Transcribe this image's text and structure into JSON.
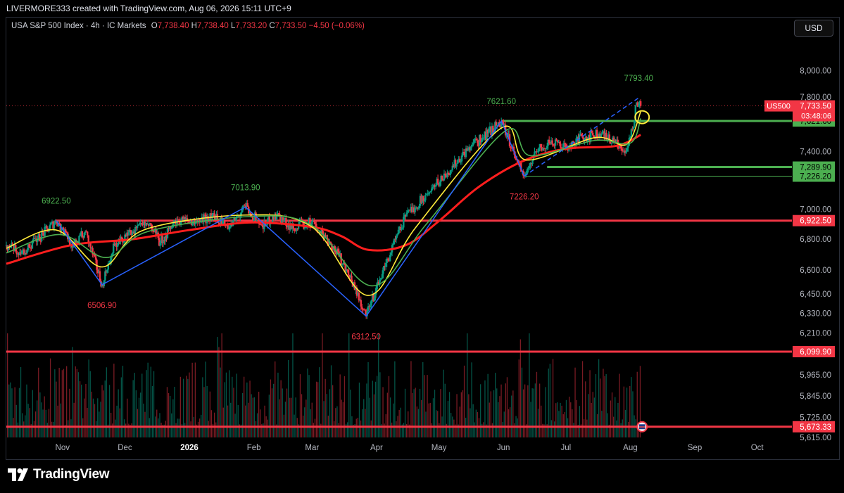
{
  "header": {
    "attribution": "LIVERMORE333 created with TradingView.com, Aug 06, 2026 15:11 UTC+9"
  },
  "legend": {
    "symbol": "USA S&P 500 Index · 4h · IC Markets",
    "o_label": "O",
    "o_value": "7,738.40",
    "h_label": "H",
    "h_value": "7,738.40",
    "l_label": "L",
    "l_value": "7,733.20",
    "c_label": "C",
    "c_value": "7,733.50",
    "change": "−4.50 (−0.06%)"
  },
  "currency_button": "USD",
  "brand": {
    "name": "TradingView"
  },
  "colors": {
    "up": "#089981",
    "down": "#f23645",
    "ma_red": "#ff1e1e",
    "ma_yellow": "#ffeb3b",
    "ma_green": "#4caf50",
    "trend": "#2962ff",
    "level_red": "#f23645",
    "level_green": "#4caf50",
    "annot_green": "#4caf50",
    "annot_red": "#f23645"
  },
  "chart_data": {
    "type": "candlestick",
    "timeframe": "4h",
    "instrument": "USA S&P 500 Index",
    "x_ticks": [
      {
        "label": "Nov",
        "date": "2025-11-01"
      },
      {
        "label": "Dec",
        "date": "2025-12-01"
      },
      {
        "label": "2026",
        "date": "2026-01-01",
        "bold": true
      },
      {
        "label": "Feb",
        "date": "2026-02-01"
      },
      {
        "label": "Mar",
        "date": "2026-03-01"
      },
      {
        "label": "Apr",
        "date": "2026-04-01"
      },
      {
        "label": "May",
        "date": "2026-05-01"
      },
      {
        "label": "Jun",
        "date": "2026-06-01"
      },
      {
        "label": "Jul",
        "date": "2026-07-01"
      },
      {
        "label": "Aug",
        "date": "2026-08-01"
      },
      {
        "label": "Sep",
        "date": "2026-09-01"
      },
      {
        "label": "Oct",
        "date": "2026-10-01"
      }
    ],
    "x_range": [
      "2025-10-05",
      "2026-10-15"
    ],
    "y_scale": "log",
    "y_range": [
      5615,
      8280
    ],
    "y_ticks": [
      "8,000.00",
      "7,800.00",
      "7,400.00",
      "7,000.00",
      "6,800.00",
      "6,600.00",
      "6,450.00",
      "6,330.00",
      "6,210.00",
      "5,965.00",
      "5,845.00",
      "5,725.00",
      "5,615.00"
    ],
    "price_path": [
      {
        "date": "2025-10-05",
        "value": 6760
      },
      {
        "date": "2025-10-12",
        "value": 6705
      },
      {
        "date": "2025-10-20",
        "value": 6800
      },
      {
        "date": "2025-10-29",
        "value": 6922.5
      },
      {
        "date": "2025-11-06",
        "value": 6760
      },
      {
        "date": "2025-11-12",
        "value": 6850
      },
      {
        "date": "2025-11-20",
        "value": 6506.9
      },
      {
        "date": "2025-11-26",
        "value": 6760
      },
      {
        "date": "2025-12-05",
        "value": 6850
      },
      {
        "date": "2025-12-12",
        "value": 6900
      },
      {
        "date": "2025-12-18",
        "value": 6780
      },
      {
        "date": "2025-12-26",
        "value": 6930
      },
      {
        "date": "2026-01-05",
        "value": 6910
      },
      {
        "date": "2026-01-12",
        "value": 6960
      },
      {
        "date": "2026-01-20",
        "value": 6870
      },
      {
        "date": "2026-01-28",
        "value": 7013.9
      },
      {
        "date": "2026-02-05",
        "value": 6890
      },
      {
        "date": "2026-02-12",
        "value": 6960
      },
      {
        "date": "2026-02-20",
        "value": 6870
      },
      {
        "date": "2026-03-01",
        "value": 6920
      },
      {
        "date": "2026-03-10",
        "value": 6770
      },
      {
        "date": "2026-03-18",
        "value": 6600
      },
      {
        "date": "2026-03-27",
        "value": 6312.5
      },
      {
        "date": "2026-04-05",
        "value": 6620
      },
      {
        "date": "2026-04-15",
        "value": 6950
      },
      {
        "date": "2026-04-25",
        "value": 7100
      },
      {
        "date": "2026-05-05",
        "value": 7250
      },
      {
        "date": "2026-05-15",
        "value": 7420
      },
      {
        "date": "2026-05-22",
        "value": 7500
      },
      {
        "date": "2026-05-31",
        "value": 7621.6
      },
      {
        "date": "2026-06-06",
        "value": 7400
      },
      {
        "date": "2026-06-11",
        "value": 7226.2
      },
      {
        "date": "2026-06-17",
        "value": 7400
      },
      {
        "date": "2026-06-24",
        "value": 7480
      },
      {
        "date": "2026-07-01",
        "value": 7430
      },
      {
        "date": "2026-07-09",
        "value": 7500
      },
      {
        "date": "2026-07-17",
        "value": 7530
      },
      {
        "date": "2026-07-24",
        "value": 7470
      },
      {
        "date": "2026-07-30",
        "value": 7400
      },
      {
        "date": "2026-08-02",
        "value": 7560
      },
      {
        "date": "2026-08-04",
        "value": 7760
      },
      {
        "date": "2026-08-06",
        "value": 7733.5
      }
    ],
    "moving_averages": [
      {
        "color": "red",
        "path": [
          {
            "date": "2025-10-05",
            "value": 6640
          },
          {
            "date": "2025-11-05",
            "value": 6760
          },
          {
            "date": "2025-12-05",
            "value": 6800
          },
          {
            "date": "2026-01-01",
            "value": 6860
          },
          {
            "date": "2026-01-30",
            "value": 6910
          },
          {
            "date": "2026-03-01",
            "value": 6880
          },
          {
            "date": "2026-03-15",
            "value": 6820
          },
          {
            "date": "2026-03-28",
            "value": 6730
          },
          {
            "date": "2026-04-15",
            "value": 6760
          },
          {
            "date": "2026-05-01",
            "value": 6920
          },
          {
            "date": "2026-05-20",
            "value": 7150
          },
          {
            "date": "2026-06-10",
            "value": 7330
          },
          {
            "date": "2026-07-01",
            "value": 7420
          },
          {
            "date": "2026-07-25",
            "value": 7440
          },
          {
            "date": "2026-08-06",
            "value": 7520
          }
        ]
      },
      {
        "color": "yellow",
        "path": [
          {
            "date": "2025-10-05",
            "value": 6740
          },
          {
            "date": "2025-10-29",
            "value": 6860
          },
          {
            "date": "2025-11-20",
            "value": 6620
          },
          {
            "date": "2025-12-10",
            "value": 6860
          },
          {
            "date": "2026-01-28",
            "value": 6960
          },
          {
            "date": "2026-03-01",
            "value": 6880
          },
          {
            "date": "2026-03-28",
            "value": 6440
          },
          {
            "date": "2026-04-20",
            "value": 6880
          },
          {
            "date": "2026-05-31",
            "value": 7570
          },
          {
            "date": "2026-06-12",
            "value": 7340
          },
          {
            "date": "2026-07-15",
            "value": 7500
          },
          {
            "date": "2026-07-30",
            "value": 7450
          },
          {
            "date": "2026-08-06",
            "value": 7690
          }
        ]
      },
      {
        "color": "green",
        "path": [
          {
            "date": "2025-10-05",
            "value": 6710
          },
          {
            "date": "2025-10-31",
            "value": 6830
          },
          {
            "date": "2025-11-22",
            "value": 6680
          },
          {
            "date": "2025-12-12",
            "value": 6850
          },
          {
            "date": "2026-01-30",
            "value": 6950
          },
          {
            "date": "2026-03-01",
            "value": 6890
          },
          {
            "date": "2026-03-30",
            "value": 6500
          },
          {
            "date": "2026-04-25",
            "value": 6900
          },
          {
            "date": "2026-06-02",
            "value": 7550
          },
          {
            "date": "2026-06-14",
            "value": 7370
          },
          {
            "date": "2026-07-15",
            "value": 7480
          },
          {
            "date": "2026-08-01",
            "value": 7460
          },
          {
            "date": "2026-08-06",
            "value": 7640
          }
        ]
      }
    ],
    "trendlines": [
      {
        "style": "solid",
        "points": [
          {
            "date": "2025-10-29",
            "value": 6922.5
          },
          {
            "date": "2025-11-20",
            "value": 6506.9
          },
          {
            "date": "2026-01-28",
            "value": 7013.9
          },
          {
            "date": "2026-03-27",
            "value": 6312.5
          },
          {
            "date": "2026-05-31",
            "value": 7621.6
          },
          {
            "date": "2026-06-11",
            "value": 7226.2
          }
        ]
      },
      {
        "style": "dashed",
        "points": [
          {
            "date": "2026-06-11",
            "value": 7226.2
          },
          {
            "date": "2026-08-05",
            "value": 7793.4
          }
        ]
      }
    ],
    "levels": [
      {
        "value": 6922.5,
        "label": "6,922.50",
        "color": "red",
        "from": "2025-10-29"
      },
      {
        "value": 6099.9,
        "label": "6,099.90",
        "color": "red",
        "from": "2025-10-05"
      },
      {
        "value": 5673.33,
        "label": "5,673.33",
        "color": "red",
        "from": "2025-10-05"
      },
      {
        "value": 7621.6,
        "label": "7,621.60",
        "color": "green",
        "from": "2026-05-31"
      },
      {
        "value": 7289.9,
        "label": "7,289.90",
        "color": "green",
        "from": "2026-06-22"
      },
      {
        "value": 7226.2,
        "label": "7,226.20",
        "color": "green",
        "from": "2026-06-11"
      }
    ],
    "annotations": [
      {
        "text": "6922.50",
        "date": "2025-10-29",
        "value": 6922.5,
        "color": "green",
        "pos": "above"
      },
      {
        "text": "6506.90",
        "date": "2025-11-20",
        "value": 6506.9,
        "color": "red",
        "pos": "below"
      },
      {
        "text": "7013.90",
        "date": "2026-01-28",
        "value": 7013.9,
        "color": "green",
        "pos": "above"
      },
      {
        "text": "6312.50",
        "date": "2026-03-27",
        "value": 6312.5,
        "color": "red",
        "pos": "below"
      },
      {
        "text": "7621.60",
        "date": "2026-05-31",
        "value": 7621.6,
        "color": "green",
        "pos": "above"
      },
      {
        "text": "7226.20",
        "date": "2026-06-11",
        "value": 7226.2,
        "color": "red",
        "pos": "below"
      },
      {
        "text": "7793.40",
        "date": "2026-08-05",
        "value": 7793.4,
        "color": "green",
        "pos": "above"
      }
    ],
    "last_price": {
      "symbol": "US500",
      "value": 7733.5,
      "label": "7,733.50",
      "countdown": "03:48:06"
    },
    "highlight_circle": {
      "date": "2026-08-05",
      "value": 7660
    }
  }
}
